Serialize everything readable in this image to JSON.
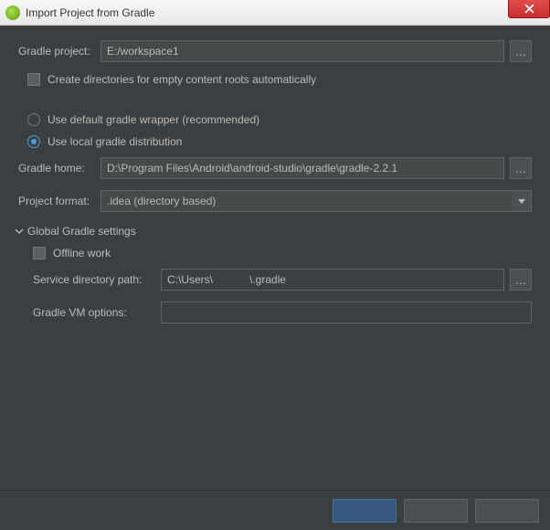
{
  "title": "Import Project from Gradle",
  "gradle_project": {
    "label": "Gradle project:",
    "value": "E:/workspace1"
  },
  "options": {
    "create_dirs": "Create directories for empty content roots automatically",
    "use_default_wrapper": "Use default gradle wrapper (recommended)",
    "use_local_dist": "Use local gradle distribution"
  },
  "gradle_home": {
    "label": "Gradle home:",
    "value": "D:\\Program Files\\Android\\android-studio\\gradle\\gradle-2.2.1"
  },
  "project_format": {
    "label": "Project format:",
    "value": ".idea (directory based)"
  },
  "global_section": {
    "header": "Global Gradle settings",
    "offline_work": "Offline work",
    "service_dir_label": "Service directory path:",
    "service_dir_value": "C:\\Users\\            \\.gradle",
    "vm_options_label": "Gradle VM options:",
    "vm_options_value": ""
  }
}
